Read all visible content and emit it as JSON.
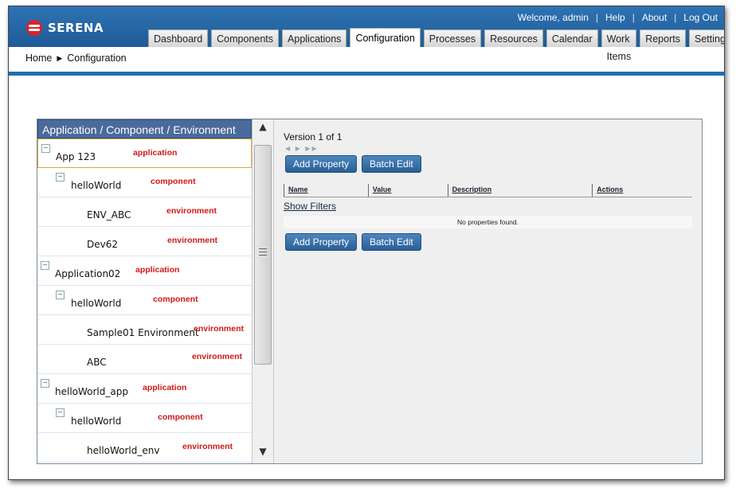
{
  "brand": {
    "name": "SERENA"
  },
  "top_links": {
    "welcome": "Welcome, admin",
    "help": "Help",
    "about": "About",
    "logout": "Log Out"
  },
  "tabs": [
    {
      "label": "Dashboard"
    },
    {
      "label": "Components"
    },
    {
      "label": "Applications"
    },
    {
      "label": "Configuration",
      "active": true
    },
    {
      "label": "Processes"
    },
    {
      "label": "Resources"
    },
    {
      "label": "Calendar"
    },
    {
      "label": "Work Items"
    },
    {
      "label": "Reports"
    },
    {
      "label": "Settings"
    }
  ],
  "breadcrumb": {
    "home": "Home",
    "current": "Configuration"
  },
  "tree": {
    "header": "Application / Component / Environment",
    "nodes": [
      {
        "label": "App 123",
        "type": "application"
      },
      {
        "label": "helloWorld",
        "type": "component"
      },
      {
        "label": "ENV_ABC",
        "type": "environment"
      },
      {
        "label": "Dev62",
        "type": "environment"
      },
      {
        "label": "Application02",
        "type": "application"
      },
      {
        "label": "helloWorld",
        "type": "component"
      },
      {
        "label": "Sample01 Environment",
        "type": "environment"
      },
      {
        "label": "ABC",
        "type": "environment"
      },
      {
        "label": "helloWorld_app",
        "type": "application"
      },
      {
        "label": "helloWorld",
        "type": "component"
      },
      {
        "label": "helloWorld_env",
        "type": "environment"
      }
    ]
  },
  "properties": {
    "version": "Version 1 of 1",
    "add_property": "Add Property",
    "batch_edit": "Batch Edit",
    "columns": [
      "Name",
      "Value",
      "Description",
      "Actions"
    ],
    "show_filters": "Show Filters",
    "empty_message": "No properties found."
  },
  "colors": {
    "header_blue": "#2f73b3",
    "tree_header": "#4a6a9c",
    "type_label_red": "#d01818",
    "selected_border": "#d6a64a",
    "button_blue": "#2a5f97"
  }
}
